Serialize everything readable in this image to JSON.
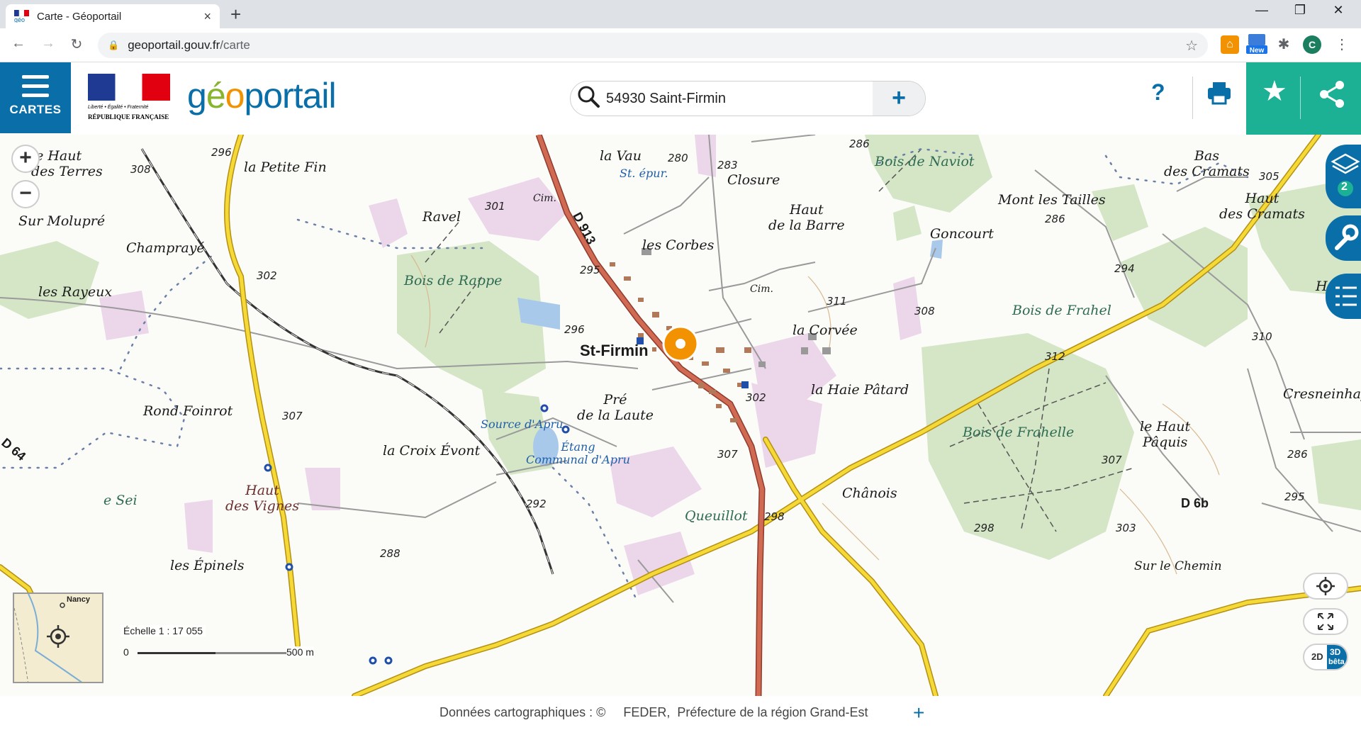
{
  "browser": {
    "tab_title": "Carte - Géoportail",
    "tab_close": "×",
    "new_tab": "+",
    "url_domain": "geoportail.gouv.fr",
    "url_path": "/carte",
    "profile_initial": "C",
    "ext_new_badge": "New",
    "min": "—",
    "max": "❐",
    "close": "✕"
  },
  "header": {
    "menu_label": "CARTES",
    "rf_motto": "Liberté • Égalité • Fraternité",
    "rf_name": "RÉPUBLIQUE FRANÇAISE",
    "logo_g": "g",
    "logo_e": "é",
    "logo_o": "o",
    "logo_rest": "portail",
    "search_value": "54930 Saint-Firmin",
    "search_plus": "+",
    "help": "?"
  },
  "map": {
    "zoom_in": "+",
    "zoom_out": "−",
    "layers_count": "2",
    "scale_label": "Échelle 1 : 17 055",
    "scale_start": "0",
    "scale_end": "500 m",
    "minimap_city": "Nancy",
    "btn_2d": "2D",
    "btn_3d": "3D",
    "btn_beta": "bêta",
    "places": [
      {
        "id": "le-haut-des-terres",
        "text": "le Haut\ndes Terres"
      },
      {
        "id": "la-petite-fin",
        "text": "la Petite Fin"
      },
      {
        "id": "la-vau",
        "text": "la Vau"
      },
      {
        "id": "st-epur",
        "text": "St. épur."
      },
      {
        "id": "closure",
        "text": "Closure"
      },
      {
        "id": "bois-de-naviot",
        "text": "Bois de Naviot"
      },
      {
        "id": "bas-des-cramats",
        "text": "Bas\ndes Cramats"
      },
      {
        "id": "sur-molupre",
        "text": "Sur Molupré"
      },
      {
        "id": "ravel",
        "text": "Ravel"
      },
      {
        "id": "cim-1",
        "text": "Cim."
      },
      {
        "id": "haut-de-la-barre",
        "text": "Haut\nde la Barre"
      },
      {
        "id": "mont-les-tailles",
        "text": "Mont les Tailles"
      },
      {
        "id": "haut-des-cramats",
        "text": "Haut\ndes Cramats"
      },
      {
        "id": "champraye",
        "text": "Champrayé"
      },
      {
        "id": "les-corbes",
        "text": "les Corbes"
      },
      {
        "id": "goncourt",
        "text": "Goncourt"
      },
      {
        "id": "les-rayeux",
        "text": "les Rayeux"
      },
      {
        "id": "bois-de-rappe",
        "text": "Bois de Rappe"
      },
      {
        "id": "cim-2",
        "text": "Cim."
      },
      {
        "id": "haut-d",
        "text": "Haut d"
      },
      {
        "id": "bois-de-frahel",
        "text": "Bois de Frahel"
      },
      {
        "id": "st-firmin",
        "text": "St-Firmin"
      },
      {
        "id": "la-corvee",
        "text": "la Corvée"
      },
      {
        "id": "la-haie-patard",
        "text": "la Haie Pâtard"
      },
      {
        "id": "cresneinhay",
        "text": "Cresneinhay"
      },
      {
        "id": "rond-foinrot",
        "text": "Rond Foinrot"
      },
      {
        "id": "pre-de-la-laute",
        "text": "Pré\nde la Laute"
      },
      {
        "id": "source-dapru",
        "text": "Source d'Apru"
      },
      {
        "id": "etang",
        "text": "Étang\nCommunal d'Apru"
      },
      {
        "id": "bois-de-frahelle",
        "text": "Bois de Frahelle"
      },
      {
        "id": "le-haut-paquis",
        "text": "le Haut\nPâquis"
      },
      {
        "id": "la-croix-evont",
        "text": "la Croix Évont"
      },
      {
        "id": "haut-des-vignes",
        "text": "Haut\ndes Vignes"
      },
      {
        "id": "chanois",
        "text": "Chânois"
      },
      {
        "id": "queuillot",
        "text": "Queuillot"
      },
      {
        "id": "les-epinels",
        "text": "les Épinels"
      },
      {
        "id": "sur-le-chemin",
        "text": "Sur le Chemin"
      },
      {
        "id": "le-sei",
        "text": "e Sei"
      },
      {
        "id": "d913",
        "text": "D 913"
      },
      {
        "id": "d64",
        "text": "D 64"
      },
      {
        "id": "d6b",
        "text": "D 6b"
      }
    ],
    "altitudes": [
      {
        "id": "a296a",
        "text": "296"
      },
      {
        "id": "a308a",
        "text": "308"
      },
      {
        "id": "a280",
        "text": "280"
      },
      {
        "id": "a283",
        "text": "283"
      },
      {
        "id": "a286a",
        "text": "286"
      },
      {
        "id": "a301",
        "text": "301"
      },
      {
        "id": "a305",
        "text": "305"
      },
      {
        "id": "a286b",
        "text": "286"
      },
      {
        "id": "a295a",
        "text": "295"
      },
      {
        "id": "a302a",
        "text": "302"
      },
      {
        "id": "a294",
        "text": "294"
      },
      {
        "id": "a311",
        "text": "311"
      },
      {
        "id": "a308b",
        "text": "308"
      },
      {
        "id": "a296b",
        "text": "296"
      },
      {
        "id": "a310",
        "text": "310"
      },
      {
        "id": "a312",
        "text": "312"
      },
      {
        "id": "a302b",
        "text": "302"
      },
      {
        "id": "a307a",
        "text": "307"
      },
      {
        "id": "a307b",
        "text": "307"
      },
      {
        "id": "a286c",
        "text": "286"
      },
      {
        "id": "a307c",
        "text": "307"
      },
      {
        "id": "a292",
        "text": "292"
      },
      {
        "id": "a298a",
        "text": "298"
      },
      {
        "id": "a295b",
        "text": "295"
      },
      {
        "id": "a303",
        "text": "303"
      },
      {
        "id": "a298b",
        "text": "298"
      },
      {
        "id": "a288",
        "text": "288"
      }
    ]
  },
  "footer": {
    "attribution": "Données cartographiques : ©     FEDER,  Préfecture de la région Grand-Est",
    "plus": "+"
  },
  "colors": {
    "brand_blue": "#0a6fa8",
    "teal": "#1cb095",
    "forest": "#cde3c0",
    "urban": "#ead2e6",
    "road_red": "#c0533f",
    "road_yellow": "#f1d230",
    "marker": "#f39200"
  }
}
